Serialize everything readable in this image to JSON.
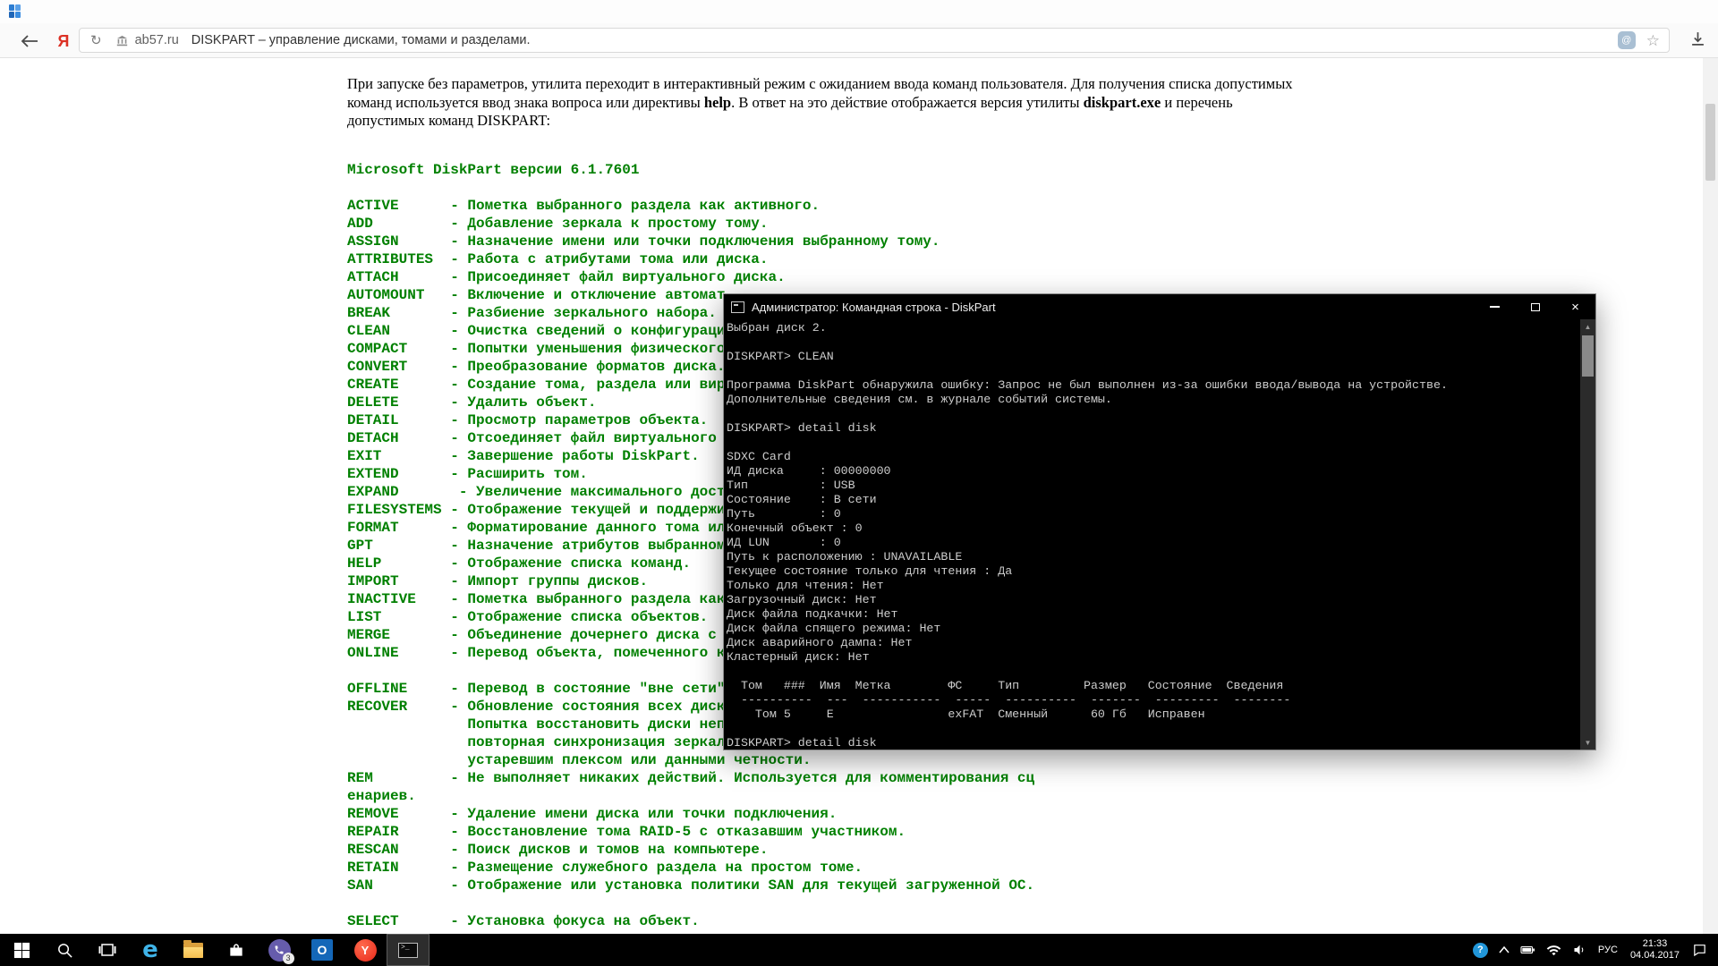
{
  "icons": {
    "refresh": "↻",
    "star": "☆",
    "protect": "@",
    "close": "×",
    "scroll_up": "▲",
    "scroll_down": "▼",
    "edge": "e",
    "outlook": "O",
    "yandex": "Y",
    "yandex_logo": "Я",
    "help": "?",
    "prompt": ">_"
  },
  "browser": {
    "url": "ab57.ru",
    "page_title": "DISKPART – управление дисками, томами и разделами.",
    "intro": {
      "line1": "При запуске без параметров, утилита переходит в интерактивный режим с ожиданием ввода команд пользователя. Для получения списка допустимых",
      "line2_pre": "команд используется ввод знака вопроса или директивы ",
      "line2_bold1": "help",
      "line2_mid": ". В ответ на это действие отображается версия утилиты ",
      "line2_bold2": "diskpart.exe",
      "line2_post": " и перечень",
      "line3": "допустимых команд DISKPART:"
    },
    "listing_lines": [
      "Microsoft DiskPart версии 6.1.7601",
      "",
      "ACTIVE      - Пометка выбранного раздела как активного.",
      "ADD         - Добавление зеркала к простому тому.",
      "ASSIGN      - Назначение имени или точки подключения выбранному тому.",
      "ATTRIBUTES  - Работа с атрибутами тома или диска.",
      "ATTACH      - Присоединяет файл виртуального диска.",
      "AUTOMOUNT   - Включение и отключение автомат",
      "BREAK       - Разбиение зеркального набора.",
      "CLEAN       - Очистка сведений о конфигураци",
      "COMPACT     - Попытки уменьшения физического",
      "CONVERT     - Преобразование форматов диска.",
      "CREATE      - Создание тома, раздела или вир",
      "DELETE      - Удалить объект.",
      "DETAIL      - Просмотр параметров объекта.",
      "DETACH      - Отсоединяет файл виртуального ",
      "EXIT        - Завершение работы DiskPart.",
      "EXTEND      - Расширить том.",
      "EXPAND       - Увеличение максимального досту",
      "FILESYSTEMS - Отображение текущей и поддержи",
      "FORMAT      - Форматирование данного тома ил",
      "GPT         - Назначение атрибутов выбранном",
      "HELP        - Отображение списка команд.",
      "IMPORT      - Импорт группы дисков.",
      "INACTIVE    - Пометка выбранного раздела как",
      "LIST        - Отображение списка объектов.",
      "MERGE       - Объединение дочернего диска с ",
      "ONLINE      - Перевод объекта, помеченного к",
      "",
      "OFFLINE     - Перевод в состояние \"вне сети\"",
      "RECOVER     - Обновление состояния всех диск",
      "              Попытка восстановить диски неп",
      "              повторная синхронизация зеркал",
      "              устаревшим плексом или данными четности.",
      "REM         - Не выполняет никаких действий. Используется для комментирования сц",
      "енариев.",
      "REMOVE      - Удаление имени диска или точки подключения.",
      "REPAIR      - Восстановление тома RAID-5 с отказавшим участником.",
      "RESCAN      - Поиск дисков и томов на компьютере.",
      "RETAIN      - Размещение служебного раздела на простом томе.",
      "SAN         - Отображение или установка политики SAN для текущей загруженной ОС.",
      "",
      "SELECT      - Установка фокуса на объект."
    ]
  },
  "console": {
    "title": "Администратор: Командная строка - DiskPart",
    "lines": [
      "Выбран диск 2.",
      "",
      "DISKPART> CLEAN",
      "",
      "Программа DiskPart обнаружила ошибку: Запрос не был выполнен из-за ошибки ввода/вывода на устройстве.",
      "Дополнительные сведения см. в журнале событий системы.",
      "",
      "DISKPART> detail disk",
      "",
      "SDXC Card",
      "ИД диска     : 00000000",
      "Тип          : USB",
      "Состояние    : В сети",
      "Путь         : 0",
      "Конечный объект : 0",
      "ИД LUN       : 0",
      "Путь к расположению : UNAVAILABLE",
      "Текущее состояние только для чтения : Да",
      "Только для чтения: Нет",
      "Загрузочный диск: Нет",
      "Диск файла подкачки: Нет",
      "Диск файла спящего режима: Нет",
      "Диск аварийного дампа: Нет",
      "Кластерный диск: Нет",
      "",
      "  Том   ###  Имя  Метка        ФС     Тип         Размер   Состояние  Сведения",
      "  ----------  ---  -----------  -----  ----------  -------  ---------  --------",
      "    Том 5     E                exFAT  Сменный      60 Гб   Исправен",
      "",
      "DISKPART> detail disk"
    ]
  },
  "taskbar": {
    "viber_badge": "3",
    "language": "РУС",
    "time": "21:33",
    "date": "04.04.2017"
  }
}
